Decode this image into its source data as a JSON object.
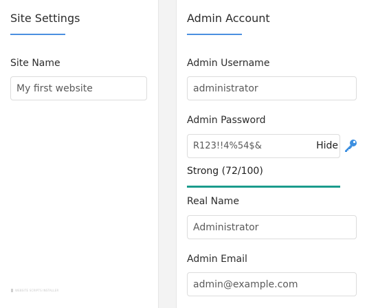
{
  "site_settings": {
    "title": "Site Settings",
    "site_name_label": "Site Name",
    "site_name_value": "My first website"
  },
  "admin_account": {
    "title": "Admin Account",
    "username_label": "Admin Username",
    "username_value": "administrator",
    "password_label": "Admin Password",
    "password_value": "R123!!4%54$&",
    "hide_label": "Hide",
    "strength_text": "Strong (72/100)",
    "strength_score": 72,
    "real_name_label": "Real Name",
    "real_name_value": "Administrator",
    "email_label": "Admin Email",
    "email_value": "admin@example.com"
  },
  "footer": {
    "watermark_text": "WEBSITE SCRIPTS INSTALLER"
  },
  "colors": {
    "accent_underline": "#4a8fe0",
    "strength_bar": "#1a9b8c",
    "key_icon": "#3c8fe0"
  },
  "icons": {
    "password_generate": "key-icon"
  }
}
